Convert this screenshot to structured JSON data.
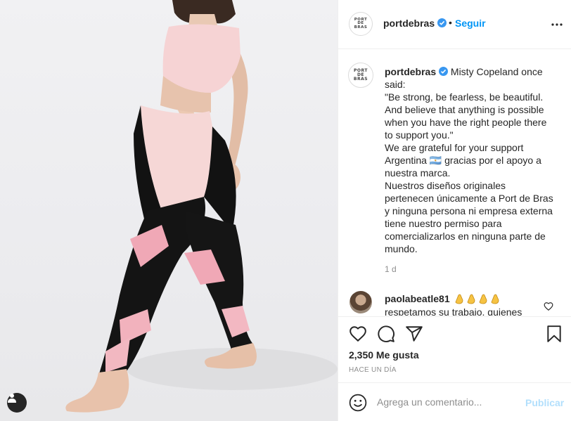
{
  "post": {
    "username": "portdebras",
    "verified": true,
    "follow_label": "Seguir",
    "separator": "•",
    "avatar_logo_lines": [
      "PORT",
      "DE",
      "BRAS"
    ]
  },
  "caption": {
    "username": "portdebras",
    "lines": [
      "Misty Copeland once said:",
      "\"Be strong, be fearless, be beautiful.",
      "And believe that anything is possible",
      "when you have the right people there",
      "to support you.\"",
      "We are grateful for your support",
      "Argentina 🇦🇷 gracias por el apoyo a",
      "nuestra marca.",
      "Nuestros diseños originales",
      "pertenecen únicamente a Port de Bras",
      "y ninguna persona ni empresa externa",
      "tiene nuestro permiso para",
      "comercializarlos en ninguna parte de",
      "mundo."
    ],
    "time_ago": "1 d"
  },
  "comment": {
    "username": "paolabeatle81",
    "text": "respetamos su trabajo, quienes"
  },
  "actions": {
    "likes": "2,350 Me gusta",
    "date": "HACE UN DÍA",
    "icons": [
      "heart-icon",
      "comment-icon",
      "share-icon",
      "bookmark-icon"
    ]
  },
  "composer": {
    "placeholder": "Agrega un comentario...",
    "publish_label": "Publicar"
  },
  "colors": {
    "accent": "#0095f6",
    "verified": "#3897f0",
    "publish_disabled": "#b2dffc",
    "text": "#262626",
    "muted": "#8e8e8e"
  }
}
